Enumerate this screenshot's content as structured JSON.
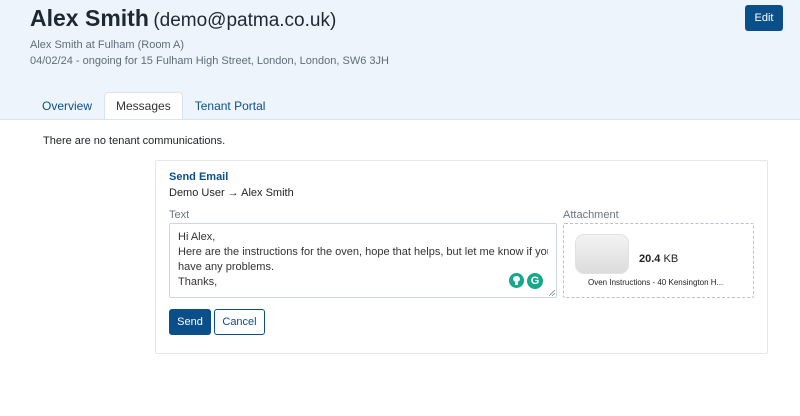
{
  "header": {
    "name": "Alex Smith",
    "email": "(demo@patma.co.uk)",
    "property_line": "Alex Smith at Fulham (Room A)",
    "tenancy_line": "04/02/24 - ongoing for 15 Fulham High Street, London, London, SW6 3JH",
    "edit_label": "Edit"
  },
  "tabs": [
    {
      "label": "Overview",
      "active": false
    },
    {
      "label": "Messages",
      "active": true
    },
    {
      "label": "Tenant Portal",
      "active": false
    }
  ],
  "messages": {
    "empty_text": "There are no tenant communications."
  },
  "send_email": {
    "heading": "Send Email",
    "from_to": "Demo User → Alex Smith",
    "text_label": "Text",
    "attachment_label": "Attachment",
    "body_lines": [
      "Hi Alex,",
      "Here are the instructions for the oven, hope that helps, but let me know if you",
      "have any problems.",
      "Thanks,"
    ],
    "attachment": {
      "size_value": "20.4",
      "size_unit": "KB",
      "name": "Oven Instructions - 40 Kensington H..."
    },
    "grammarly_letter": "G",
    "send_label": "Send",
    "cancel_label": "Cancel"
  },
  "colors": {
    "primary": "#0b4f8a",
    "header_bg": "#eef4fb",
    "grammarly": "#15a88a"
  }
}
